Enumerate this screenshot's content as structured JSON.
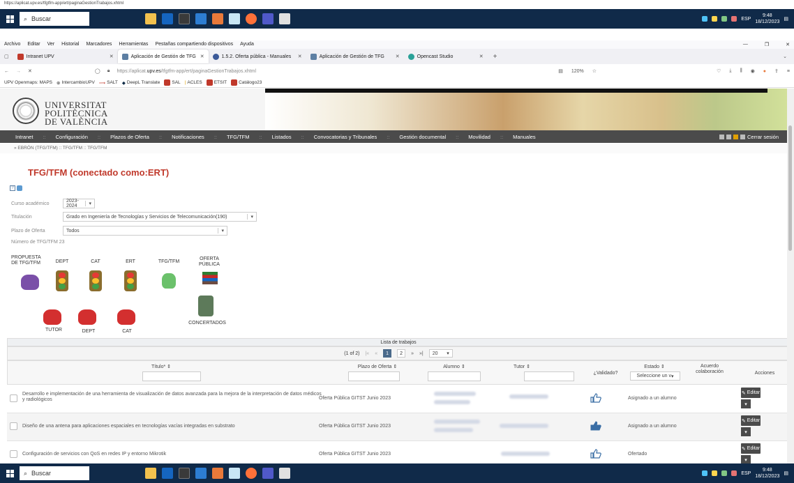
{
  "url_tooltip": "https://aplicat.upv.es/tfgtfm-app/ert/paginaGestionTrabajos.xhtml",
  "taskbar": {
    "search": "Buscar",
    "time": "9:48",
    "date": "18/12/2023",
    "lang": "ESP"
  },
  "menubar": [
    "Archivo",
    "Editar",
    "Ver",
    "Historial",
    "Marcadores",
    "Herramientas",
    "Pestañas compartiendo dispositivos",
    "Ayuda"
  ],
  "tabs": [
    {
      "label": "Intranet UPV",
      "color": "#c0392b"
    },
    {
      "label": "Aplicación de Gestión de TFG",
      "color": "#5d7fa3"
    },
    {
      "label": "1.5.2. Oferta pública - Manuales",
      "color": "#3b5998"
    },
    {
      "label": "Aplicación de Gestión de TFG",
      "color": "#5d7fa3"
    },
    {
      "label": "Opencast Studio",
      "color": "#2aa198"
    }
  ],
  "address": {
    "prefix": "https://aplicat.",
    "domain": "upv.es",
    "path": "/tfgtfm-app/ert/paginaGestionTrabajos.xhtml",
    "zoom": "120%"
  },
  "bookmarks": [
    "UPV Openmaps: MAPS",
    "IntercambioUPV",
    "SALT",
    "DeepL Translate",
    "SAL",
    "ACLES",
    "ETSIT",
    "Catálogo23"
  ],
  "logo": {
    "line1": "UNIVERSITAT",
    "line2": "POLITÈCNICA",
    "line3": "DE VALÈNCIA"
  },
  "nav": [
    "Intranet",
    "Configuración",
    "Plazos de Oferta",
    "Notificaciones",
    "TFG/TFM",
    "Listados",
    "Convocatorias y Tribunales",
    "Gestión documental",
    "Movilidad",
    "Manuales"
  ],
  "logout": "Cerrar sesión",
  "breadcrumb": "EBRÓN (TFG/TFM) :: TFG/TFM :: TFG/TFM",
  "page_title": "TFG/TFM (conectado como:ERT)",
  "form": {
    "curso_label": "Curso académico",
    "curso_value": "2023-2024",
    "titulacion_label": "Titulación",
    "titulacion_value": "Grado en Ingeniería de Tecnologías y Servicios de Telecomunicación(190)",
    "plazo_label": "Plazo de Oferta",
    "plazo_value": "Todos",
    "numero_label": "Número de TFG/TFM",
    "numero_value": "23"
  },
  "workflow": {
    "propuesta": "PROPUESTA DE TFG/TFM",
    "dept": "DEPT",
    "cat": "CAT",
    "ert": "ERT",
    "tfgtfm": "TFG/TFM",
    "oferta": "OFERTA PÚBLICA",
    "tutor": "TUTOR",
    "dept2": "DEPT",
    "cat2": "CAT",
    "concertados": "CONCERTADOS"
  },
  "list": {
    "title": "Lista de trabajos",
    "pager": {
      "info": "(1 of 2)",
      "page1": "1",
      "page2": "2",
      "per_page": "20"
    },
    "headers": {
      "titulo": "Título* ⇕",
      "plazo": "Plazo de Oferta ⇕",
      "alumno": "Alumno ⇕",
      "tutor": "Tutor ⇕",
      "validado": "¿Validado?",
      "estado": "Estado ⇕",
      "estado_select": "Seleccione un v",
      "acuerdo": "Acuerdo colaboración",
      "acciones": "Acciones"
    },
    "rows": [
      {
        "title": "Desarrollo e implementación de una herramienta de visualización de datos avanzada para la mejora de la interpretación de datos médicos y radiológicos",
        "plazo": "Oferta Pública GITST Junio 2023",
        "estado": "Asignado a un alumno",
        "edit": "Editar"
      },
      {
        "title": "Diseño de una antena para aplicaciones espaciales en tecnologías vacías integradas en substrato",
        "plazo": "Oferta Pública GITST Junio 2023",
        "estado": "Asignado a un alumno",
        "edit": "Editar"
      },
      {
        "title": "Configuración de servicios con QoS en redes IP y entorno Mikrotik",
        "plazo": "Oferta Pública GITST Junio 2023",
        "estado": "Ofertado",
        "edit": "Editar"
      }
    ]
  }
}
